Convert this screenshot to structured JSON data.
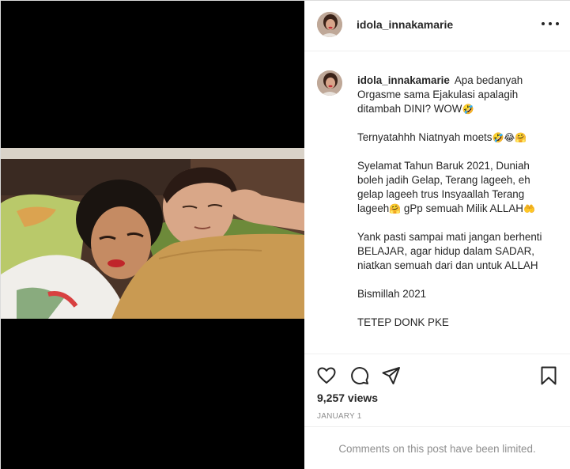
{
  "post": {
    "username": "idola_innakamarie",
    "caption": {
      "line1": "Apa bedanyah Orgasme sama Ejakulasi apalagih ditambah DINI? WOW",
      "line1_emoji": "🤣",
      "line2": "Ternyatahhh Niatnyah moets",
      "line2_emoji": "🤣😂🤗",
      "line3a": "Syelamat Tahun Baruk 2021, Duniah boleh jadih Gelap, Terang lageeh, eh gelap lageeh trus Insyaallah Terang lageeh",
      "line3_emoji1": "🤗",
      "line3b": " gPp semuah Milik ALLAH",
      "line3_emoji2": "🤲",
      "line4": "Yank pasti sampai mati jangan berhenti BELAJAR, agar hidup dalam SADAR, niatkan semuah dari dan untuk ALLAH",
      "line5": "Bismillah 2021",
      "line6": "TETEP DONK PKE"
    },
    "views": "9,257 views",
    "date": "JANUARY 1",
    "comments_notice": "Comments on this post have been limited."
  },
  "icons": {
    "more": "more-options-icon",
    "like": "heart-icon",
    "comment": "comment-bubble-icon",
    "share": "paper-plane-icon",
    "save": "bookmark-icon"
  },
  "colors": {
    "text": "#262626",
    "secondary": "#8e8e8e",
    "border": "#dbdbdb",
    "media_bg": "#000000"
  }
}
